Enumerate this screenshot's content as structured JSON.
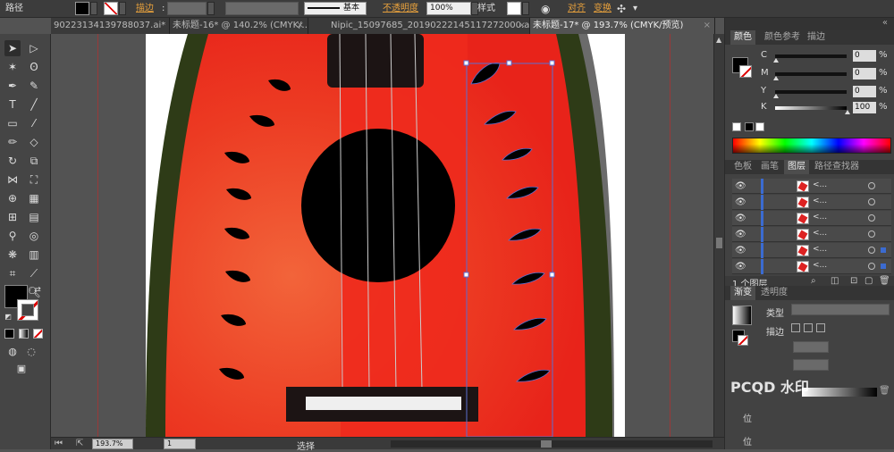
{
  "control_bar": {
    "mode_label": "路径",
    "stroke_label": "描边",
    "stroke_style": "基本",
    "opacity_label": "不透明度",
    "opacity_value": "100%",
    "style_label": "样式",
    "align_label": "对齐",
    "transform_label": "变换"
  },
  "tabs": [
    {
      "label": "90223134139788037.ai*",
      "active": false
    },
    {
      "label": "未标题-16* @ 140.2% (CMYK/...",
      "active": false
    },
    {
      "label": "Nipic_15097685_20190222145117272000.ai*",
      "active": false
    },
    {
      "label": "未标题-17* @ 193.7% (CMYK/预览)",
      "active": true
    }
  ],
  "status_bar": {
    "zoom": "193.7%",
    "artboard": "1",
    "tool": "选择"
  },
  "color_panel": {
    "tabs": [
      "颜色",
      "颜色参考",
      "描边"
    ],
    "channels": [
      {
        "name": "C",
        "value": "0",
        "unit": "%"
      },
      {
        "name": "M",
        "value": "0",
        "unit": "%"
      },
      {
        "name": "Y",
        "value": "0",
        "unit": "%"
      },
      {
        "name": "K",
        "value": "100",
        "unit": "%"
      }
    ]
  },
  "layers_panel": {
    "tabs": [
      "色板",
      "画笔",
      "图层",
      "路径查找器"
    ],
    "footer": "1 个图层",
    "rows": 6
  },
  "gradient_panel": {
    "tabs": [
      "渐变",
      "透明度"
    ],
    "type_label": "类型",
    "stroke_label": "描边",
    "location_label": "位",
    "location_label_2": "位"
  },
  "watermark": "PCQD 水印",
  "colors": {
    "rind": "#2e3b17",
    "flesh": "#e8231a",
    "flesh_light": "#f2643a",
    "seed": "#000000",
    "selection": "#5b6fd1"
  }
}
